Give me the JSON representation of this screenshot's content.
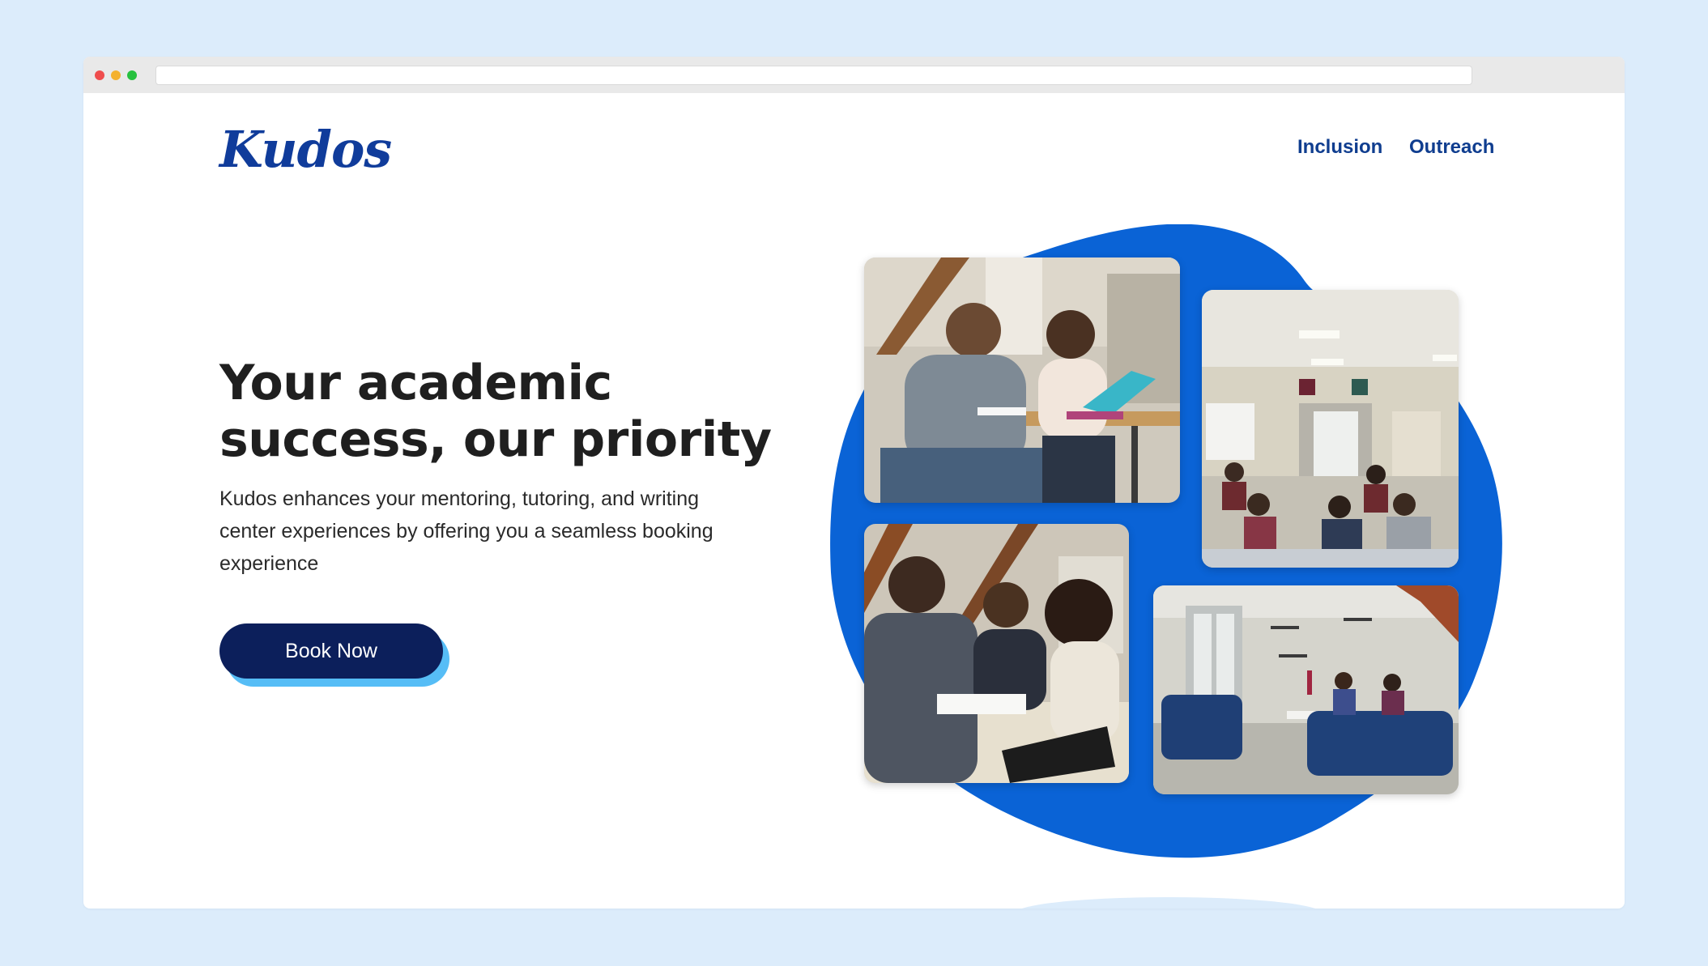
{
  "brand": {
    "logo_text": "Kudos",
    "primary_color": "#103c9b",
    "accent_blob": "#0a63d6",
    "cta_shadow": "#56bdf6",
    "cta_color": "#0c1f5b"
  },
  "nav": {
    "items": [
      {
        "label": "Inclusion"
      },
      {
        "label": "Outreach"
      }
    ]
  },
  "hero": {
    "title_line1": "Your academic",
    "title_line2": "success, our priority",
    "description": "Kudos enhances your mentoring, tutoring, and writing center experiences by offering you a seamless booking experience",
    "cta_label": "Book Now"
  }
}
